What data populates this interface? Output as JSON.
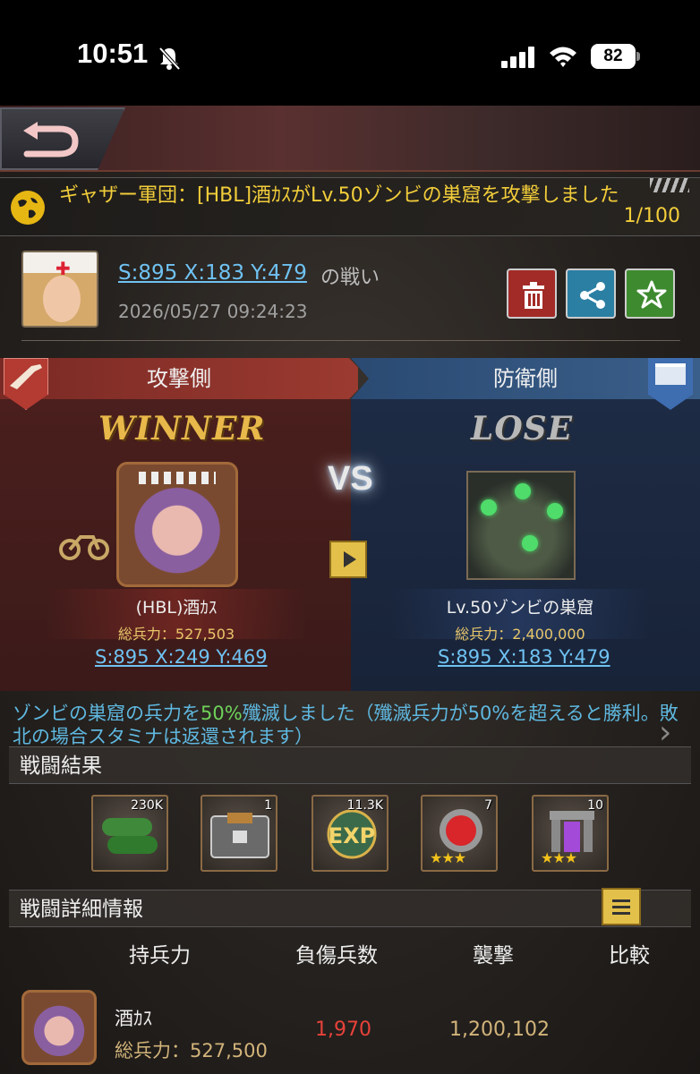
{
  "status_bar": {
    "time": "10:51",
    "battery": "82"
  },
  "notice": {
    "text": "ギャザー軍団：[HBL]酒ｶｽがLv.50ゾンビの巣窟を攻撃しました",
    "counter": "1/100"
  },
  "report": {
    "location_link": "S:895 X:183 Y:479",
    "battle_suffix": "の戦い",
    "timestamp": "2026/05/27 09:24:23"
  },
  "battle": {
    "attacker_label": "攻撃側",
    "defender_label": "防衛側",
    "winner_text": "WINNER",
    "lose_text": "LOSE",
    "vs_text": "VS",
    "attacker": {
      "name": "(HBL)酒ｶｽ",
      "power": "総兵力：527,503",
      "coords": "S:895 X:249 Y:469"
    },
    "defender": {
      "name": "Lv.50ゾンビの巣窟",
      "power": "総兵力：2,400,000",
      "coords": "S:895 X:183 Y:479"
    }
  },
  "result_note": {
    "part1": "ゾンビの巣窟の兵力を",
    "highlight": "50%",
    "part2": "殲滅しました（殲滅兵力が50%を超えると勝利。敗北の場合スタミナは返還されます）"
  },
  "results": {
    "title": "戦闘結果",
    "rewards": [
      {
        "icon": "fuel-tank-icon",
        "count": "230K"
      },
      {
        "icon": "supply-crate-icon",
        "count": "1"
      },
      {
        "icon": "exp-icon",
        "count": "11.3K"
      },
      {
        "icon": "red-gem-icon",
        "count": "7",
        "stars": "★★★"
      },
      {
        "icon": "purple-portal-icon",
        "count": "10",
        "stars": "★★★"
      }
    ]
  },
  "details": {
    "title": "戦闘詳細情報",
    "columns": [
      "持兵力",
      "負傷兵数",
      "襲撃",
      "比較"
    ],
    "row": {
      "name": "酒ｶｽ",
      "power": "総兵力：527,500",
      "wounded": "1,970",
      "attack": "1,200,102"
    }
  },
  "colors": {
    "accent_gold": "#e8b84a",
    "link_blue": "#6fc2f2",
    "attacker_red": "#9b3a30",
    "defender_blue": "#3a5f8a",
    "notice_yellow": "#f2cd3a",
    "wounded_red": "#e8423a"
  }
}
